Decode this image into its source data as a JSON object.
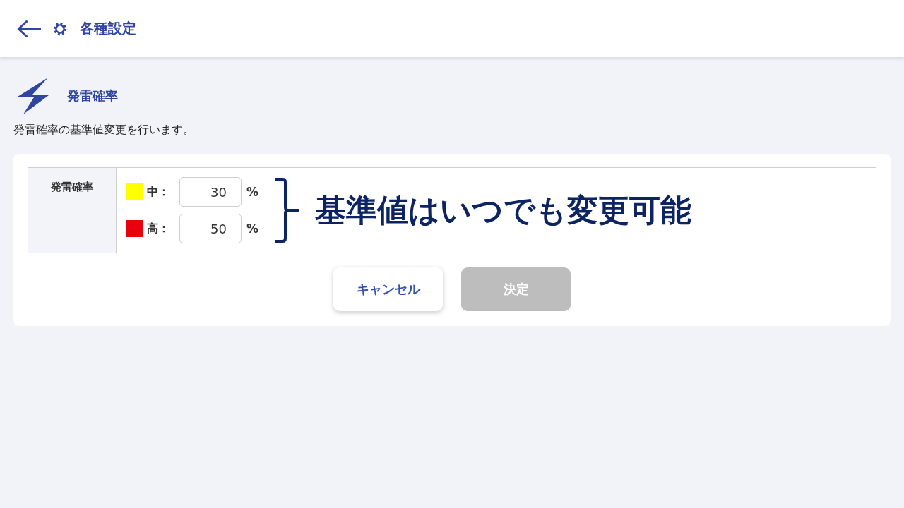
{
  "header": {
    "title": "各種設定"
  },
  "section": {
    "title": "発雷確率",
    "description": "発雷確率の基準値変更を行います。"
  },
  "settings_table": {
    "row_header": "発雷確率",
    "levels": [
      {
        "label": "中：",
        "color": "#ffff00",
        "value": "30",
        "unit": "%"
      },
      {
        "label": "高：",
        "color": "#e8000f",
        "value": "50",
        "unit": "%"
      }
    ]
  },
  "annotation": {
    "text": "基準値はいつでも変更可能"
  },
  "buttons": [
    {
      "label": "キャンセル",
      "kind": "secondary",
      "disabled": false
    },
    {
      "label": "決定",
      "kind": "primary",
      "disabled": true
    }
  ]
}
